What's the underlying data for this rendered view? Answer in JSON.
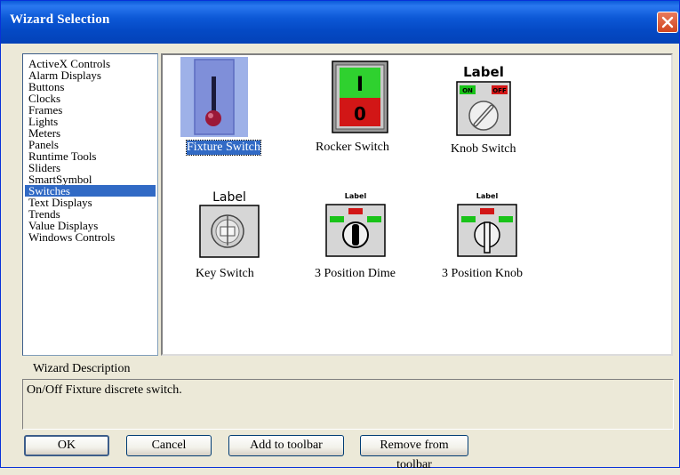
{
  "window": {
    "title": "Wizard Selection",
    "close_icon": "close-icon"
  },
  "categories": [
    "ActiveX Controls",
    "Alarm Displays",
    "Buttons",
    "Clocks",
    "Frames",
    "Lights",
    "Meters",
    "Panels",
    "Runtime Tools",
    "Sliders",
    "SmartSymbol",
    "Switches",
    "Text Displays",
    "Trends",
    "Value Displays",
    "Windows Controls"
  ],
  "selected_category": "Switches",
  "wizards": [
    {
      "name": "Fixture Switch",
      "selected": true
    },
    {
      "name": "Rocker Switch",
      "rocker_on": "I",
      "rocker_off": "0"
    },
    {
      "name": "Knob Switch",
      "label": "Label",
      "on": "ON",
      "off": "OFF"
    },
    {
      "name": "Key Switch",
      "label": "Label"
    },
    {
      "name": "3 Position Dime",
      "label": "Label"
    },
    {
      "name": "3 Position Knob",
      "label": "Label"
    }
  ],
  "description": {
    "label": "Wizard Description",
    "text": "On/Off Fixture discrete switch."
  },
  "buttons": {
    "ok": "OK",
    "cancel": "Cancel",
    "add": "Add to toolbar",
    "remove": "Remove from  toolbar"
  },
  "colors": {
    "title_bar": "#0449c4",
    "selection": "#316ac5",
    "close": "#d2461f"
  }
}
